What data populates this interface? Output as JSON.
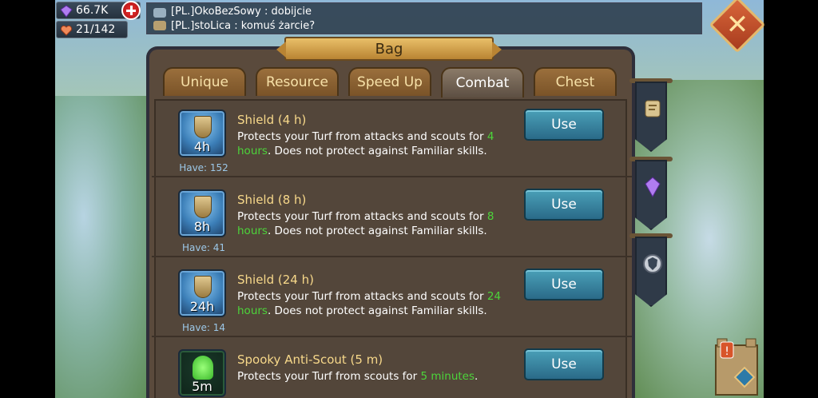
{
  "resources": {
    "gems": "66.7K",
    "health": "21/142"
  },
  "chat": {
    "lines": [
      "[PL.]OkoBezSowy : dobijcie",
      "[PL.]stoLica : komuś żarcie?"
    ]
  },
  "panel": {
    "title": "Bag",
    "tabs": [
      "Unique",
      "Resource",
      "Speed Up",
      "Combat",
      "Chest"
    ],
    "active_tab": "Combat"
  },
  "items": [
    {
      "name": "Shield (4 h)",
      "icon_label": "4h",
      "have": "Have: 152",
      "desc_pre": "Protects your Turf from attacks and scouts for ",
      "desc_hl": "4 hours",
      "desc_post": ". Does not protect against Familiar skills.",
      "button": "Use"
    },
    {
      "name": "Shield (8 h)",
      "icon_label": "8h",
      "have": "Have: 41",
      "desc_pre": "Protects your Turf from attacks and scouts for ",
      "desc_hl": "8 hours",
      "desc_post": ". Does not protect against Familiar skills.",
      "button": "Use"
    },
    {
      "name": "Shield (24 h)",
      "icon_label": "24h",
      "have": "Have: 14",
      "desc_pre": "Protects your Turf from attacks and scouts for ",
      "desc_hl": "24 hours",
      "desc_post": ". Does not protect against Familiar skills.",
      "button": "Use"
    },
    {
      "name": "Spooky Anti-Scout (5 m)",
      "icon_label": "5m",
      "have": "",
      "desc_pre": "Protects your Turf from scouts for ",
      "desc_hl": "5 minutes",
      "desc_post": ".",
      "button": "Use"
    }
  ],
  "colors": {
    "highlight": "#4cd43a",
    "item_name": "#f7d88a",
    "use_button": "#2a6a88"
  },
  "icons": {
    "gems": "gem-icon",
    "health": "heart-icon",
    "close": "close-icon",
    "side": [
      "quest-icon",
      "crystal-icon",
      "guild-shield-icon"
    ]
  }
}
